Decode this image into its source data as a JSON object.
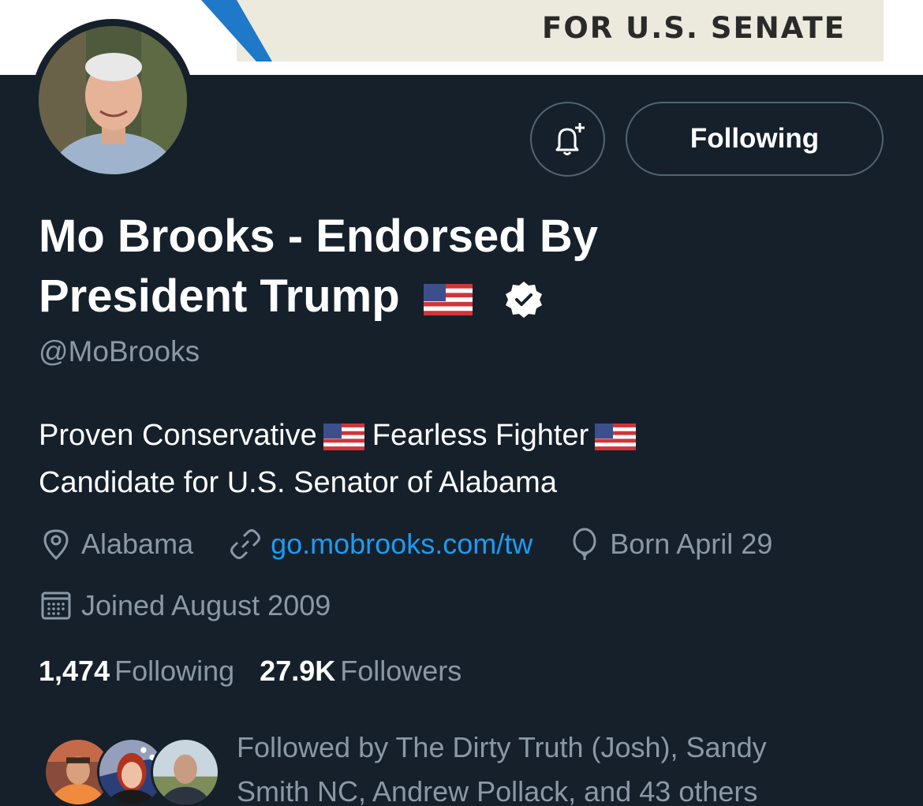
{
  "banner": {
    "text": "FOR U.S. SENATE"
  },
  "profile": {
    "display_name": "Mo Brooks - Endorsed By President Trump",
    "flag_emoji": "🇺🇸",
    "verified": true,
    "handle": "@MoBrooks"
  },
  "actions": {
    "notify_icon": "bell-plus-icon",
    "follow_label": "Following"
  },
  "bio": {
    "line1_a": "Proven Conservative",
    "line1_b": "Fearless Fighter",
    "line2": "Candidate for U.S. Senator of Alabama"
  },
  "meta": {
    "location": "Alabama",
    "website": "go.mobrooks.com/tw",
    "birthday": "Born April 29",
    "joined": "Joined August 2009"
  },
  "stats": {
    "following_count": "1,474",
    "following_label": "Following",
    "followers_count": "27.9K",
    "followers_label": "Followers"
  },
  "followed_by": {
    "text": "Followed by The Dirty Truth (Josh), Sandy Smith NC, Andrew Pollack, and 43 others"
  },
  "colors": {
    "background": "#15202b",
    "secondary_text": "#8b98a5",
    "link": "#1d9bf0",
    "border": "#536471"
  }
}
